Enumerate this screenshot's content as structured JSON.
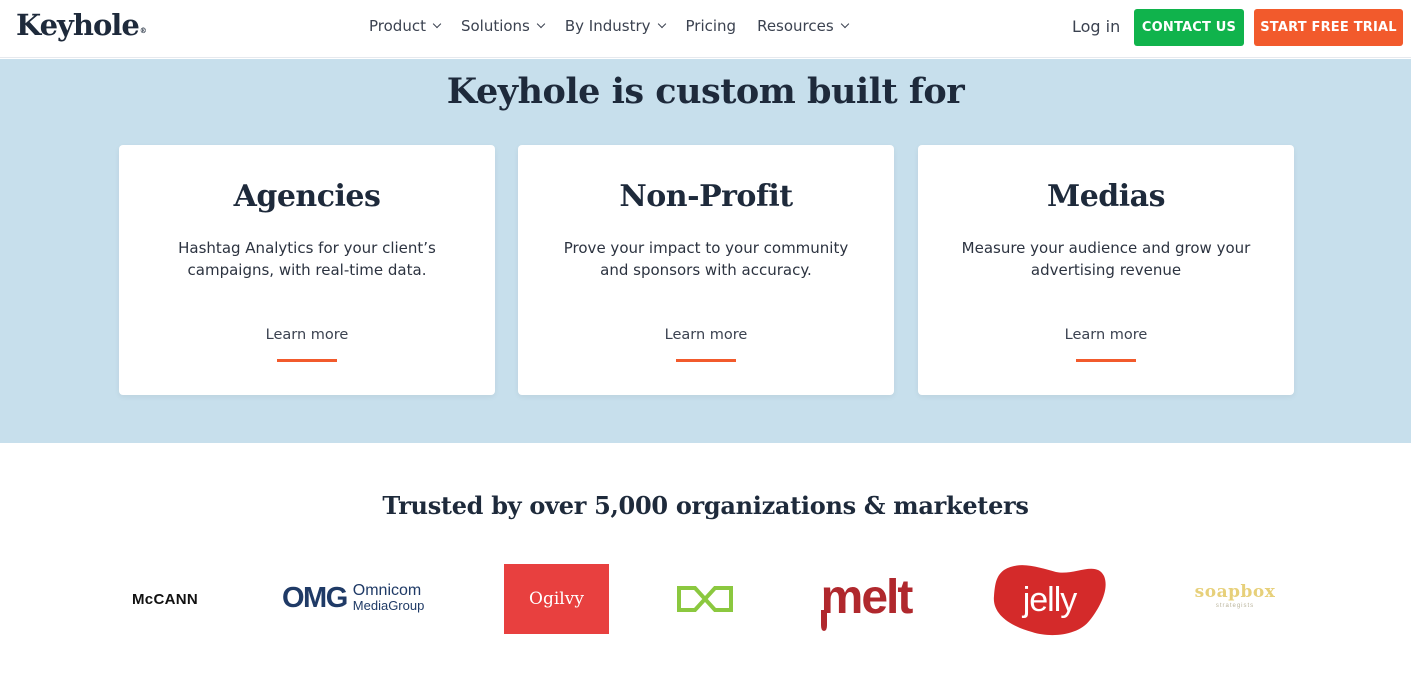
{
  "brand": {
    "name": "Keyhole",
    "mark": "®"
  },
  "nav": {
    "items": [
      {
        "label": "Product",
        "dropdown": true
      },
      {
        "label": "Solutions",
        "dropdown": true
      },
      {
        "label": "By Industry",
        "dropdown": true
      },
      {
        "label": "Pricing",
        "dropdown": false
      },
      {
        "label": "Resources",
        "dropdown": true
      }
    ],
    "login": "Log in",
    "contact": "CONTACT US",
    "trial": "START FREE TRIAL"
  },
  "custom": {
    "title": "Keyhole is custom built for",
    "cards": [
      {
        "title": "Agencies",
        "desc": "Hashtag Analytics for your client’s campaigns, with real-time data.",
        "link": "Learn more"
      },
      {
        "title": "Non-Profit",
        "desc": "Prove your impact to your community and sponsors with accuracy.",
        "link": "Learn more"
      },
      {
        "title": "Medias",
        "desc": "Measure your audience and grow your advertising revenue",
        "link": "Learn more"
      }
    ]
  },
  "trusted": {
    "title": "Trusted by over 5,000 organizations & marketers",
    "logos": {
      "mccann": "McCANN",
      "omg_mark": "OMG",
      "omg_line1": "Omnicom",
      "omg_line2": "MediaGroup",
      "ogilvy": "Ogilvy",
      "melt": "melt",
      "jelly": "jelly",
      "soapbox": "soapbox",
      "soapbox_sub": "strategists"
    }
  },
  "colors": {
    "green": "#10b34c",
    "orange": "#f25a2c",
    "section_bg": "#c7dfec",
    "ogilvy_red": "#e8403f",
    "melt_red": "#b0282d",
    "jelly_red": "#d42a2a",
    "lime": "#8bc83f"
  }
}
